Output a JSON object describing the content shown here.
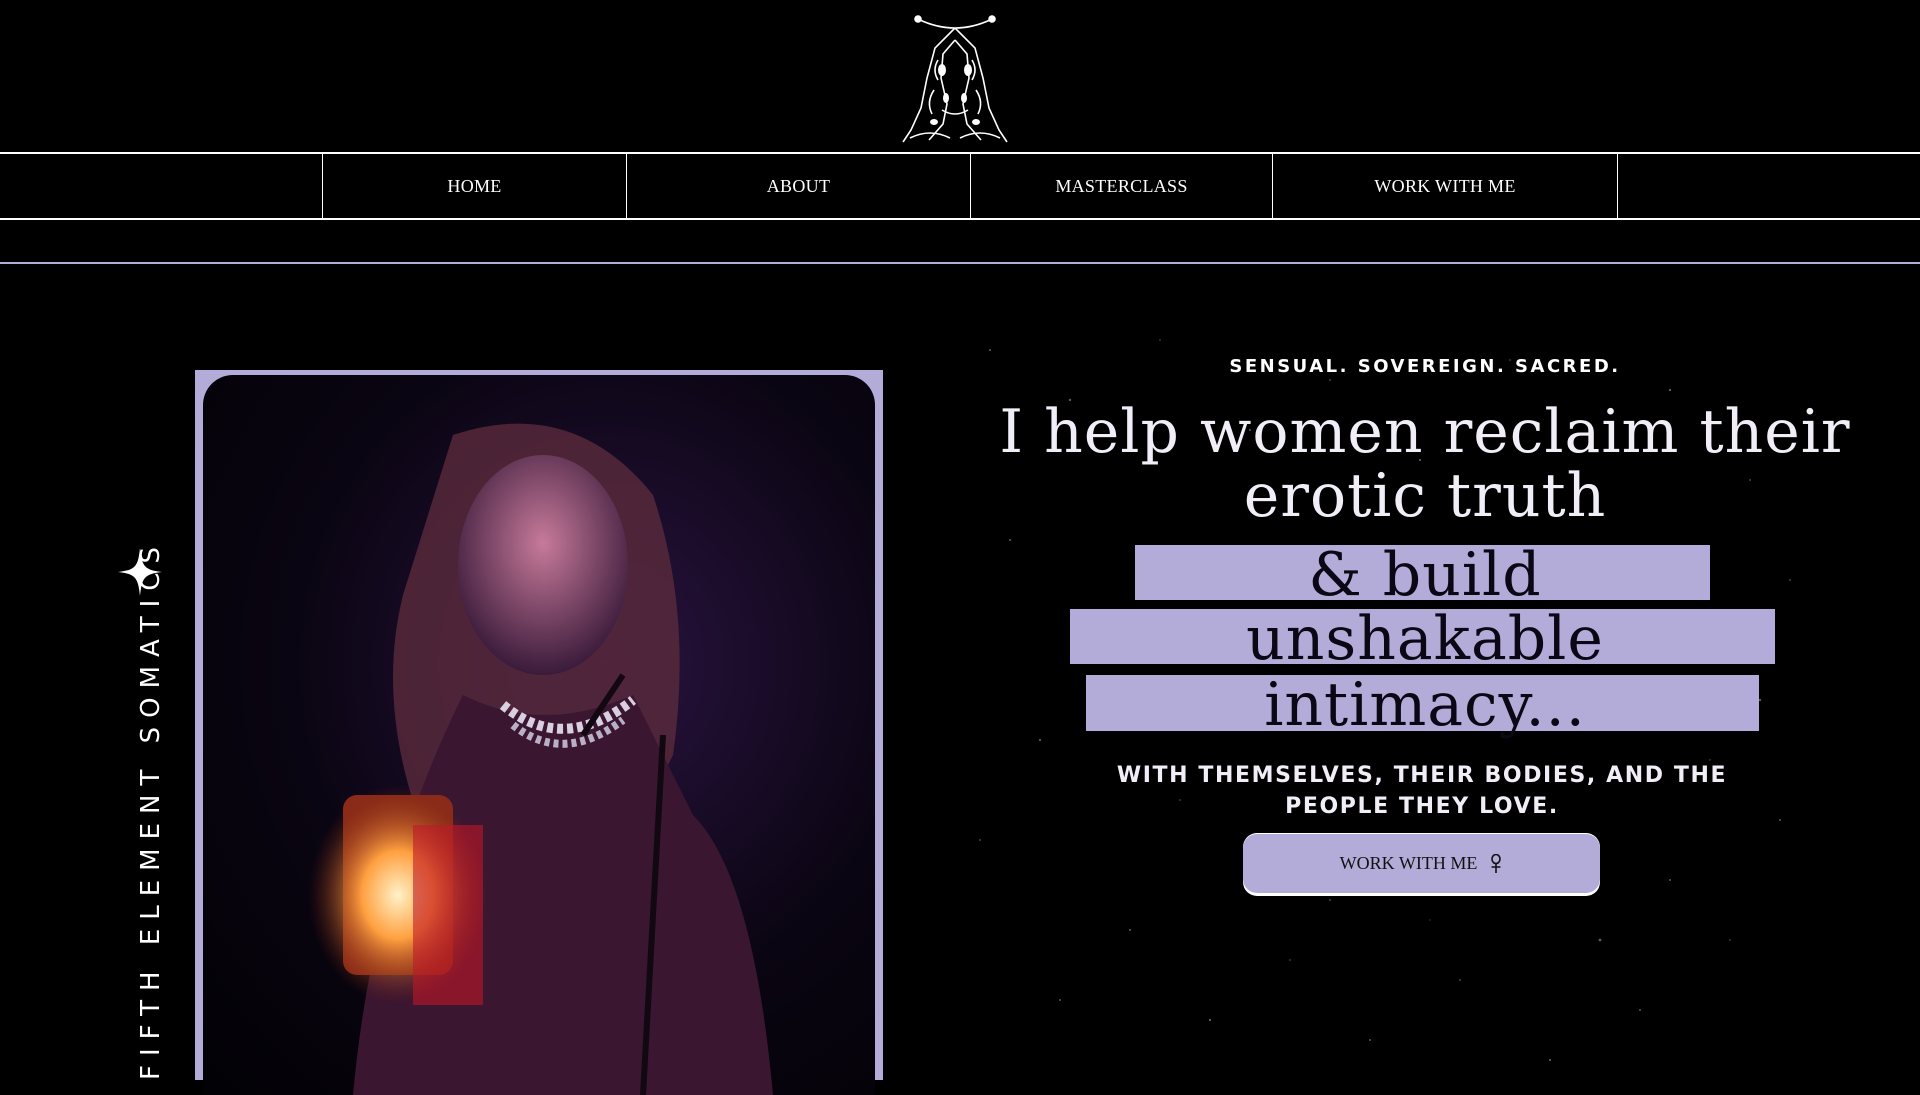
{
  "brand": {
    "logo_icon": "twin-tigers-emblem-icon"
  },
  "nav": {
    "items": [
      {
        "label": "HOME"
      },
      {
        "label": "ABOUT"
      },
      {
        "label": "MASTERCLASS"
      },
      {
        "label": "WORK WITH ME"
      }
    ]
  },
  "side": {
    "vertical_text": "FIFTH ELEMENT SOMATICS",
    "icon": "four-point-star-icon"
  },
  "hero": {
    "eyebrow": "SENSUAL. SOVEREIGN. SACRED.",
    "headline_line1": "I help women reclaim their",
    "headline_line2": "erotic truth",
    "highlight_line1": "& build",
    "highlight_line2": "unshakable",
    "highlight_line3": "intimacy...",
    "subline": "WITH THEMSELVES, THEIR BODIES, AND THE PEOPLE THEY LOVE.",
    "cta_label": "WORK WITH ME",
    "cta_icon": "venus-ankh-icon"
  },
  "colors": {
    "background": "#000000",
    "accent": "#b3acd8",
    "text": "#ffffff"
  }
}
